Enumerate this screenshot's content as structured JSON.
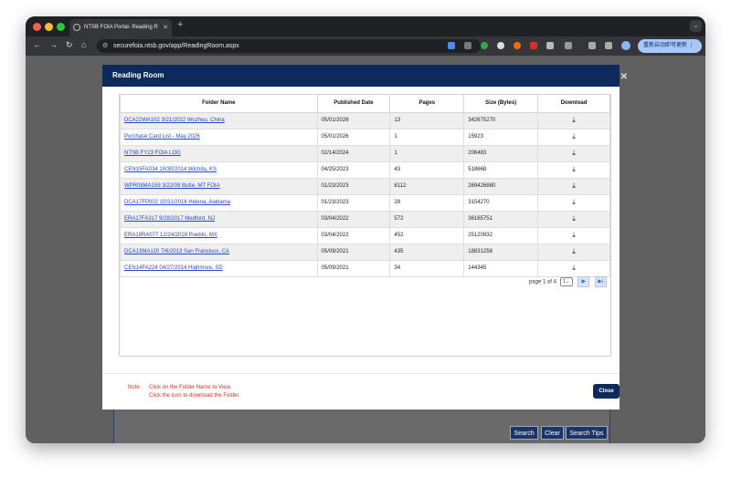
{
  "browser": {
    "tab_title": "NTSB FOIA Portal- Reading R",
    "tab_close": "✕",
    "new_tab": "+",
    "url": "securefoia.ntsb.gov/app/ReadingRoom.aspx",
    "update_button": "重新启动即可更新 ⋮",
    "colors": {
      "close": "#ff5f57",
      "minimize": "#febc2e",
      "maximize": "#28c840"
    }
  },
  "modal": {
    "title": "Reading Room",
    "columns": [
      "Folder Name",
      "Published Date",
      "Pages",
      "Size (Bytes)",
      "Download"
    ],
    "rows": [
      {
        "name": "DCA22WA102 3/21/2022 Wuzhou, China",
        "date": "05/01/2026",
        "pages": "13",
        "size": "342675270"
      },
      {
        "name": "Purchase Card List - May 2026",
        "date": "05/01/2026",
        "pages": "1",
        "size": "15923"
      },
      {
        "name": "NTSB FY23 FOIA LOG",
        "date": "02/14/2024",
        "pages": "1",
        "size": "206483"
      },
      {
        "name": "CEN15FA034 10/30/2014 Wichita, KS",
        "date": "04/25/2023",
        "pages": "43",
        "size": "518668"
      },
      {
        "name": "WPR08MA159 3/22/09 Butte, MT FOIA",
        "date": "01/23/2023",
        "pages": "8112",
        "size": "269426880"
      },
      {
        "name": "DCA17FP002 10/31/2016 Helena, Alabama",
        "date": "01/23/2023",
        "pages": "28",
        "size": "3154270"
      },
      {
        "name": "ERA17FA317 9/28/2017 Medford, NJ",
        "date": "03/04/2022",
        "pages": "572",
        "size": "36165751"
      },
      {
        "name": "ERA19RA077 12/24/2018 Pueblo, MX",
        "date": "03/04/2022",
        "pages": "452",
        "size": "25120932"
      },
      {
        "name": "DCA13MA120 7/6/2013 San Francisco, CA",
        "date": "05/09/2021",
        "pages": "435",
        "size": "18831258"
      },
      {
        "name": "CEN14FA224 04/27/2014 Highmore, SD",
        "date": "05/09/2021",
        "pages": "34",
        "size": "144345"
      }
    ],
    "pager": {
      "text": "page 1 of 4",
      "select": "1",
      "next": "▶",
      "last": "▶|"
    },
    "note_label": "Note:",
    "note_line1": "Click on the Folder Name to View.",
    "note_line2": "Click the icon to download the Folder.",
    "close_button": "Close"
  },
  "page_buttons": {
    "search": "Search",
    "clear": "Clear",
    "tips": "Search Tips"
  }
}
